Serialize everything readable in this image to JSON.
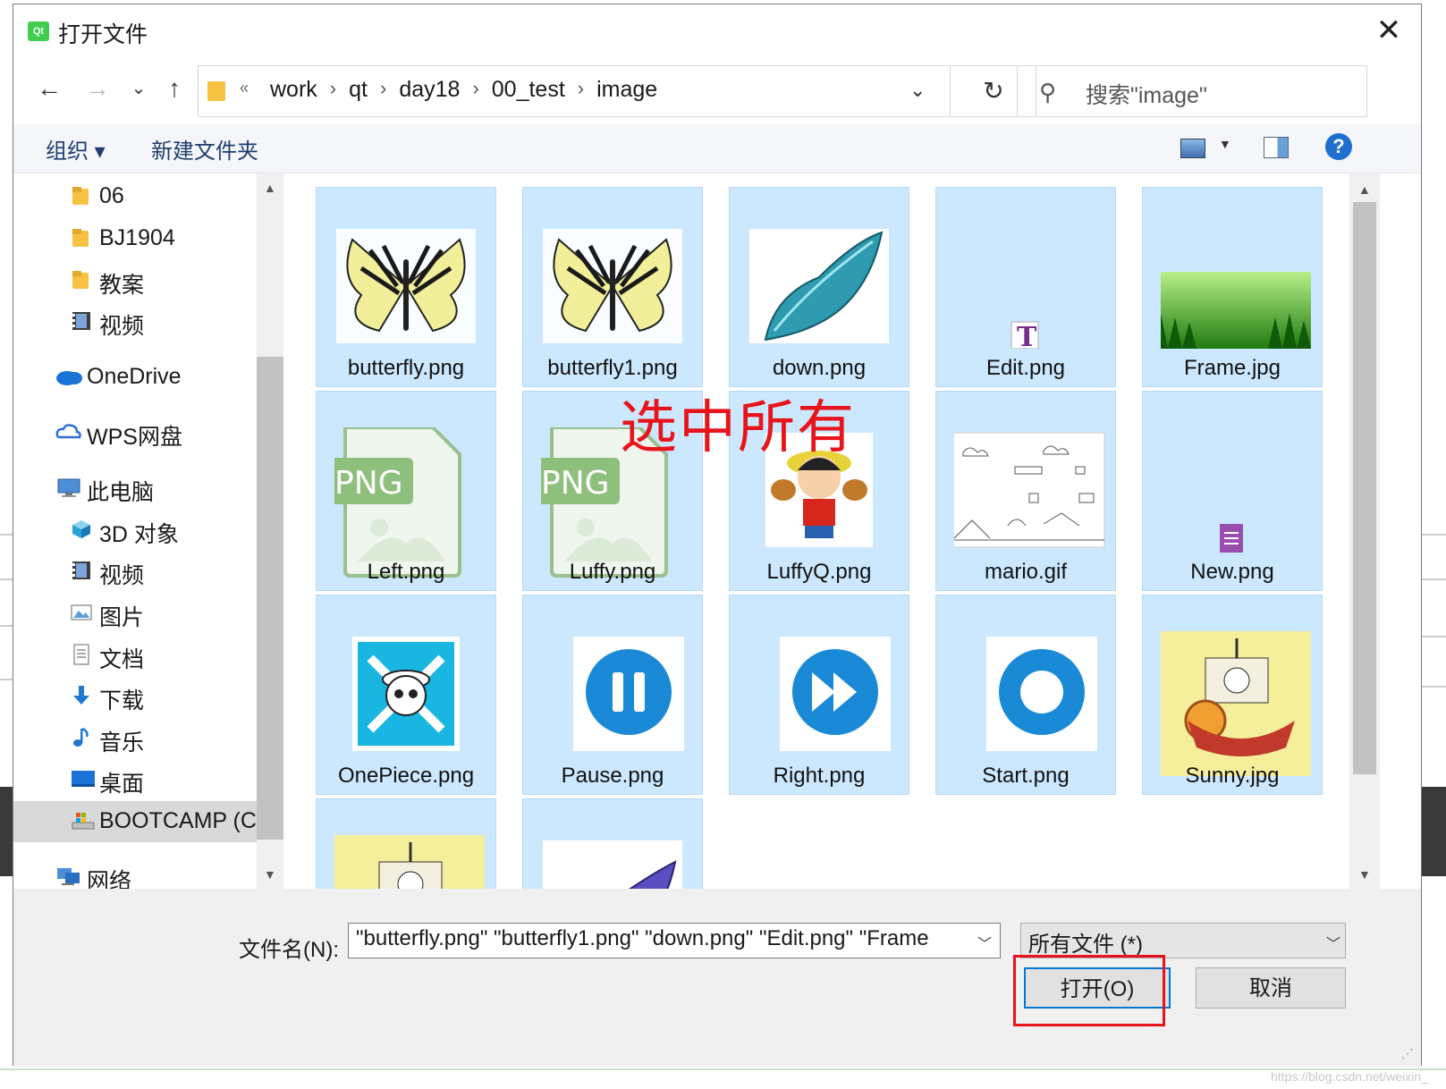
{
  "window": {
    "title": "打开文件",
    "app_icon_text": "Qt",
    "close_label": "✕"
  },
  "nav": {
    "back": "←",
    "forward": "→",
    "recent": "⌄",
    "up": "↑",
    "refresh": "↻",
    "dropdown": "⌄"
  },
  "address": {
    "overflow": "«",
    "crumbs": [
      "work",
      "qt",
      "day18",
      "00_test",
      "image"
    ]
  },
  "search": {
    "placeholder": "搜索\"image\""
  },
  "toolbar": {
    "organize": "组织 ▾",
    "new_folder": "新建文件夹",
    "help": "?"
  },
  "sidebar": {
    "items": [
      {
        "label": "06",
        "icon": "folder-icon"
      },
      {
        "label": "BJ1904",
        "icon": "folder-icon"
      },
      {
        "label": "教案",
        "icon": "folder-icon"
      },
      {
        "label": "视频",
        "icon": "video-icon"
      },
      {
        "label": "OneDrive",
        "icon": "cloud-icon"
      },
      {
        "label": "WPS网盘",
        "icon": "cloud-outline-icon"
      },
      {
        "label": "此电脑",
        "icon": "computer-icon"
      },
      {
        "label": "3D 对象",
        "icon": "cube-icon"
      },
      {
        "label": "视频",
        "icon": "video-icon"
      },
      {
        "label": "图片",
        "icon": "picture-icon"
      },
      {
        "label": "文档",
        "icon": "document-icon"
      },
      {
        "label": "下载",
        "icon": "download-icon"
      },
      {
        "label": "音乐",
        "icon": "music-icon"
      },
      {
        "label": "桌面",
        "icon": "desktop-icon"
      },
      {
        "label": "BOOTCAMP (C:",
        "icon": "drive-icon",
        "selected": true
      },
      {
        "label": "网络",
        "icon": "network-icon"
      }
    ]
  },
  "files": [
    {
      "name": "butterfly.png",
      "thumb": "butterfly-yellow"
    },
    {
      "name": "butterfly1.png",
      "thumb": "butterfly-yellow"
    },
    {
      "name": "down.png",
      "thumb": "butterfly-teal"
    },
    {
      "name": "Edit.png",
      "thumb": "text-file"
    },
    {
      "name": "Frame.jpg",
      "thumb": "forest"
    },
    {
      "name": "Left.png",
      "thumb": "png-generic"
    },
    {
      "name": "Luffy.png",
      "thumb": "png-generic"
    },
    {
      "name": "LuffyQ.png",
      "thumb": "luffy"
    },
    {
      "name": "mario.gif",
      "thumb": "mario"
    },
    {
      "name": "New.png",
      "thumb": "doc-file"
    },
    {
      "name": "OnePiece.png",
      "thumb": "skull"
    },
    {
      "name": "Pause.png",
      "thumb": "pause"
    },
    {
      "name": "Right.png",
      "thumb": "forward"
    },
    {
      "name": "Start.png",
      "thumb": "record"
    },
    {
      "name": "Sunny.jpg",
      "thumb": "ship"
    },
    {
      "name": "",
      "thumb": "ship"
    },
    {
      "name": "",
      "thumb": "butterfly-blue"
    }
  ],
  "annotation": "选中所有",
  "bottom": {
    "filename_label": "文件名(N):",
    "filename_value": "\"butterfly.png\" \"butterfly1.png\" \"down.png\" \"Edit.png\" \"Frame",
    "filetype_value": "所有文件 (*)",
    "open_label": "打开(O)",
    "cancel_label": "取消"
  },
  "colors": {
    "selection": "#cce8ff",
    "accent": "#0078d7",
    "annotation": "#e8141b"
  }
}
